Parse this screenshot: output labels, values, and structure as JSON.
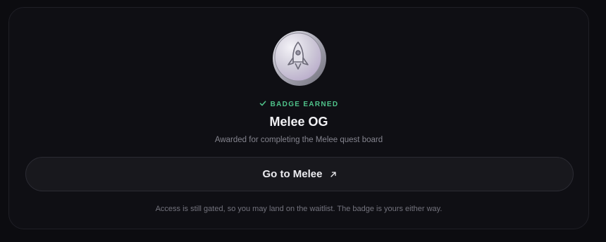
{
  "badge": {
    "icon": "rocket-coin-icon",
    "status_label": "BADGE EARNED",
    "status_color": "#4fc28a",
    "name": "Melee OG",
    "description": "Awarded for completing the Melee quest board"
  },
  "action": {
    "label": "Go to Melee",
    "icon": "arrow-up-right-icon"
  },
  "footer": {
    "note": "Access is still gated, so you may land on the waitlist. The badge is yours either way."
  }
}
